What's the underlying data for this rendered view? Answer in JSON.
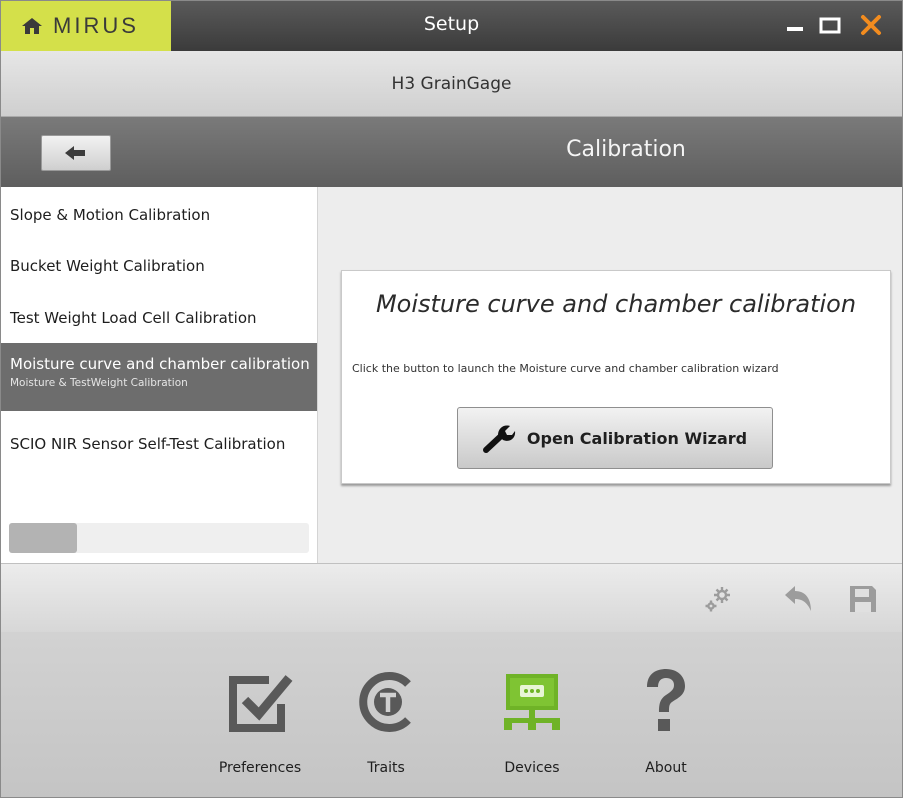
{
  "app": {
    "brand": "MIRUS",
    "window_title": "Setup"
  },
  "device": {
    "name": "H3 GrainGage"
  },
  "section": {
    "title": "Calibration"
  },
  "calibration_list": {
    "items": [
      {
        "label": "Slope & Motion Calibration"
      },
      {
        "label": "Bucket Weight Calibration"
      },
      {
        "label": "Test Weight Load Cell Calibration"
      },
      {
        "label": "Moisture curve and chamber calibration",
        "sublabel": "Moisture & TestWeight Calibration",
        "selected": true
      },
      {
        "label": "SCIO NIR Sensor Self-Test Calibration"
      }
    ],
    "scroll_position": 0
  },
  "card": {
    "title": "Moisture curve and chamber calibration",
    "description": "Click the button to launch the Moisture curve and chamber calibration wizard",
    "button_label": "Open Calibration Wizard",
    "button_icon": "wrench-icon"
  },
  "toolbar": {
    "icons": [
      "gears-icon",
      "undo-icon",
      "save-icon"
    ]
  },
  "bottom_nav": {
    "items": [
      {
        "label": "Preferences",
        "icon": "checkbox-icon"
      },
      {
        "label": "Traits",
        "icon": "trait-t-icon"
      },
      {
        "label": "Devices",
        "icon": "device-monitor-icon",
        "active": true
      },
      {
        "label": "About",
        "icon": "question-icon"
      }
    ]
  },
  "colors": {
    "brand_accent": "#d4e04a",
    "close_button": "#f28c1f",
    "active_nav": "#6fb327",
    "selected_item": "#6d6d6d"
  }
}
